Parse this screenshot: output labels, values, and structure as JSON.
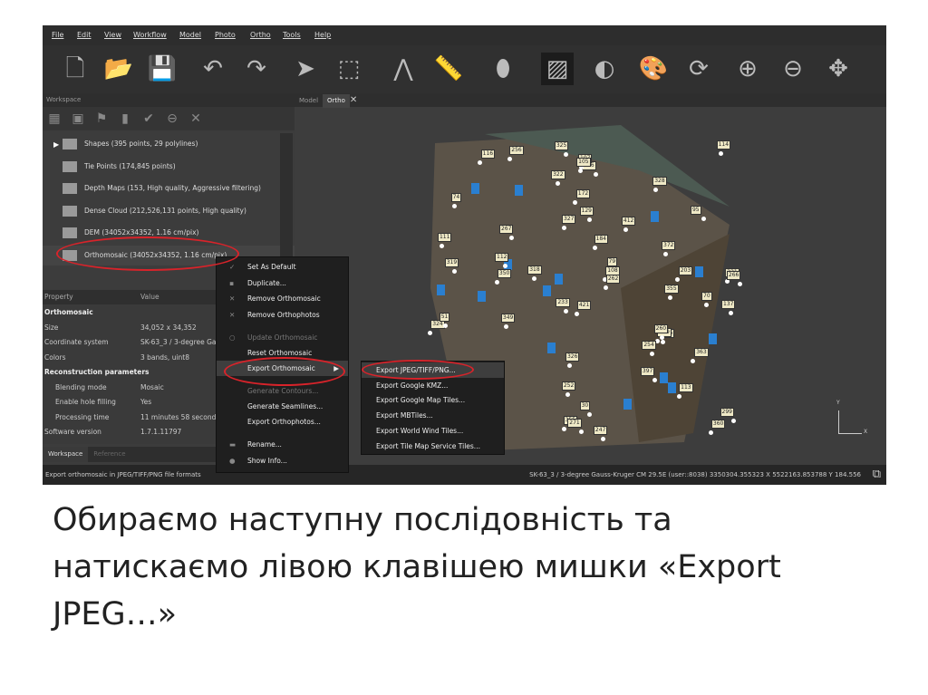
{
  "menu": [
    "File",
    "Edit",
    "View",
    "Workflow",
    "Model",
    "Photo",
    "Ortho",
    "Tools",
    "Help"
  ],
  "toolbar_icons": [
    "new-file-icon",
    "open-folder-icon",
    "save-icon",
    "undo-icon",
    "redo-icon",
    "pointer-icon",
    "rectangle-select-icon",
    "polyline-icon",
    "ruler-icon",
    "shape-icon",
    "orthomosaic-icon",
    "contrast-icon",
    "palette-icon",
    "refresh-icon",
    "zoom-in-icon",
    "zoom-out-icon",
    "move-icon"
  ],
  "workspace": {
    "title": "Workspace",
    "items": [
      {
        "label": "Shapes (395 points, 29 polylines)"
      },
      {
        "label": "Tie Points (174,845 points)"
      },
      {
        "label": "Depth Maps (153, High quality, Aggressive filtering)"
      },
      {
        "label": "Dense Cloud (212,526,131 points, High quality)"
      },
      {
        "label": "DEM (34052x34352, 1.16 cm/pix)"
      },
      {
        "label": "Orthomosaic (34052x34352, 1.16 cm/pix)"
      }
    ]
  },
  "view_tabs": [
    "Model",
    "Ortho"
  ],
  "properties": {
    "header": [
      "Property",
      "Value"
    ],
    "rows": [
      {
        "k": "Orthomosaic",
        "v": "",
        "bold": true
      },
      {
        "k": "Size",
        "v": "34,052 x 34,352"
      },
      {
        "k": "Coordinate system",
        "v": "SK-63_3 / 3-degree Gau"
      },
      {
        "k": "Colors",
        "v": "3 bands, uint8"
      },
      {
        "k": "Reconstruction parameters",
        "v": "",
        "bold": true
      },
      {
        "k": "Blending mode",
        "v": "Mosaic",
        "indent": true
      },
      {
        "k": "Enable hole filling",
        "v": "Yes",
        "indent": true
      },
      {
        "k": "Processing time",
        "v": "11 minutes 58 seconds",
        "indent": true
      },
      {
        "k": "Software version",
        "v": "1.7.1.11797"
      }
    ]
  },
  "bottom_tabs": [
    "Workspace",
    "Reference"
  ],
  "status_left": "Export orthomosaic in JPEG/TIFF/PNG file formats",
  "status_right": "SK-63_3 / 3-degree Gauss-Kruger CM 29.5E (user::8038)  3350304.355323 X  5522163.853788 Y  184.556",
  "context_menu": [
    {
      "label": "Set As Default",
      "icon": "✓"
    },
    {
      "label": "Duplicate...",
      "icon": "▪"
    },
    {
      "label": "Remove Orthomosaic",
      "icon": "✕"
    },
    {
      "label": "Remove Orthophotos",
      "icon": "✕"
    },
    {
      "label": "Update Orthomosaic",
      "disabled": true,
      "icon": "○"
    },
    {
      "label": "Reset Orthomosaic"
    },
    {
      "label": "Export Orthomosaic",
      "highlight": true,
      "submenu": true
    },
    {
      "label": "Generate Contours...",
      "disabled": true
    },
    {
      "label": "Generate Seamlines..."
    },
    {
      "label": "Export Orthophotos..."
    },
    {
      "label": "Rename...",
      "icon": "▬"
    },
    {
      "label": "Show Info...",
      "icon": "●"
    }
  ],
  "submenu": [
    "Export JPEG/TIFF/PNG...",
    "Export Google KMZ...",
    "Export Google Map Tiles...",
    "Export MBTiles...",
    "Export World Wind Tiles...",
    "Export Tile Map Service Tiles..."
  ],
  "axis": {
    "y": "Y",
    "x": "X"
  },
  "markers": [
    "421",
    "216",
    "79",
    "75",
    "129",
    "172",
    "360",
    "355",
    "233",
    "221",
    "184",
    "372",
    "340",
    "349",
    "389",
    "350",
    "319",
    "318",
    "252",
    "327",
    "328",
    "299",
    "260",
    "111",
    "112",
    "114",
    "108",
    "266",
    "262",
    "256",
    "254",
    "95",
    "116",
    "113",
    "107",
    "105",
    "267",
    "324",
    "322",
    "325",
    "326",
    "412",
    "80",
    "74",
    "51",
    "70",
    "72",
    "30",
    "271",
    "397",
    "247",
    "203",
    "137",
    "355",
    "363"
  ],
  "colors": {
    "accent_red": "#d8232a",
    "gcp_blue": "#2a7fd0"
  },
  "caption": "Обираємо наступну послідовність та натискаємо лівою клавішею мишки «Export JPEG…»"
}
